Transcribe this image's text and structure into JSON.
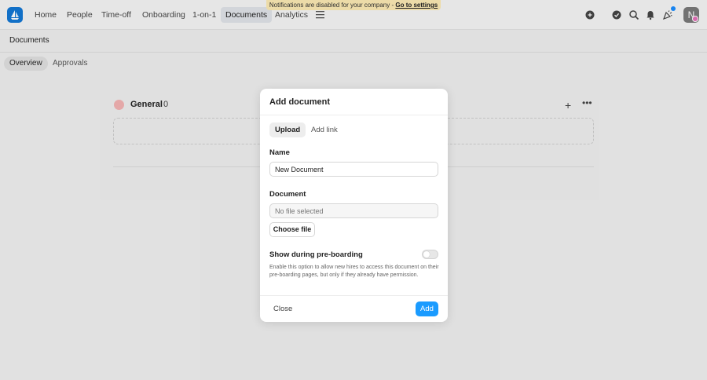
{
  "nav": {
    "items": [
      {
        "label": "Home"
      },
      {
        "label": "People"
      },
      {
        "label": "Time-off"
      },
      {
        "label": "Onboarding"
      },
      {
        "label": "1-on-1"
      },
      {
        "label": "Documents"
      },
      {
        "label": "Analytics"
      }
    ],
    "active": "Documents",
    "banner_text": "Notifications are disabled for your company - ",
    "banner_link": "Go to settings",
    "avatar_initial": "N"
  },
  "page": {
    "title": "Documents",
    "tabs": [
      {
        "label": "Overview"
      },
      {
        "label": "Approvals"
      }
    ],
    "active_tab": "Overview"
  },
  "group": {
    "title": "General",
    "count": "0"
  },
  "modal": {
    "title": "Add document",
    "segments": [
      {
        "label": "Upload"
      },
      {
        "label": "Add link"
      }
    ],
    "active_segment": "Upload",
    "name_label": "Name",
    "name_value": "New Document",
    "document_label": "Document",
    "document_placeholder": "No file selected",
    "choose_file_label": "Choose file",
    "preboarding_label": "Show during pre-boarding",
    "preboarding_enabled": false,
    "preboarding_help": "Enable this option to allow new hires to access this document on their pre-boarding pages, but only if they already have permission.",
    "close_label": "Close",
    "add_label": "Add"
  },
  "colors": {
    "accent": "#1a9bff",
    "logo": "#1478d4",
    "banner": "#fbe9b3"
  }
}
